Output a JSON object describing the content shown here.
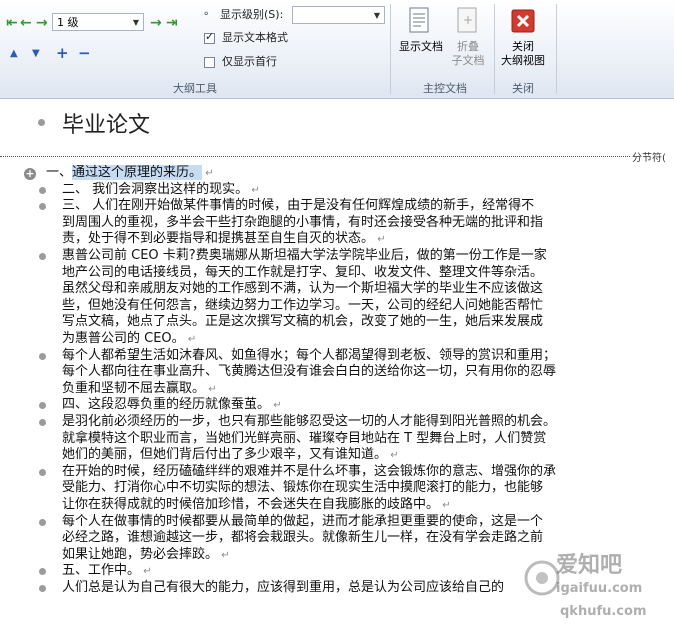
{
  "ribbon": {
    "level_select": "1 级",
    "show_level_label": "显示级别(S):",
    "show_level_value": "",
    "show_text_format": {
      "label": "显示文本格式",
      "checked": true
    },
    "first_line_only": {
      "label": "仅显示首行",
      "checked": false
    },
    "outline_group_label": "大纲工具",
    "show_document": "显示文档",
    "collapse_subdocs_line1": "折叠",
    "collapse_subdocs_line2": "子文档",
    "master_group_label": "主控文档",
    "close_outline_line1": "关闭",
    "close_outline_line2": "大纲视图",
    "close_group_label": "关闭"
  },
  "document": {
    "title": "毕业论文",
    "section_break": "分节符(",
    "paragraph_mark": "↵",
    "lines": [
      "一、通过这个原理的来历。",
      "二、      我们会洞察出这样的现实。",
      "三、      人们在刚开始做某件事情的时候，由于是没有任何辉煌成绩的新手，经常得不",
      "到周围人的重视，多半会干些打杂跑腿的小事情，有时还会接受各种无端的批评和指",
      "责，处于得不到必要指导和提携甚至自生自灭的状态。",
      "惠普公司前 CEO 卡莉?费奥瑞娜从斯坦福大学法学院毕业后，做的第一份工作是一家",
      "地产公司的电话接线员，每天的工作就是打字、复印、收发文件、整理文件等杂活。",
      "虽然父母和亲戚朋友对她的工作感到不满，认为一个斯坦福大学的毕业生不应该做这",
      "些，但她没有任何怨言，继续边努力工作边学习。一天，公司的经纪人问她能否帮忙",
      "写点文稿，她点了点头。正是这次撰写文稿的机会，改变了她的一生，她后来发展成",
      "为惠普公司的 CEO。",
      "每个人都希望生活如沐春风、如鱼得水；每个人都渴望得到老板、领导的赏识和重用；",
      "每个人都向往在事业高升、飞黄腾达但没有谁会白白的送给你这一切，只有用你的忍辱",
      "负重和坚韧不屈去赢取。",
      "四、这段忍辱负重的经历就像蚕茧。",
      "是羽化前必须经历的一步，也只有那些能够忍受这一切的人才能得到阳光普照的机会。",
      "就拿模特这个职业而言，当她们光鲜亮丽、璀璨夺目地站在 T 型舞台上时，人们赞赏",
      "她们的美丽，但她们背后付出了多少艰辛，又有谁知道。",
      "在开始的时候，经历磕磕绊绊的艰难并不是什么坏事，这会锻炼你的意志、增强你的承",
      "受能力、打消你心中不切实际的想法、锻炼你在现实生活中摸爬滚打的能力，也能够",
      "让你在获得成就的时候倍加珍惜，不会迷失在自我膨胀的歧路中。",
      "每个人在做事情的时候都要从最简单的做起，进而才能承担更重要的使命，这是一个",
      "必经之路，谁想逾越这一步，都将会栽跟头。就像新生儿一样，在没有学会走路之前",
      "如果让她跑，势必会摔跤。",
      "五、工作中。",
      "人们总是认为自己有很大的能力，应该得到重用，总是认为公司应该给自己的"
    ]
  },
  "watermark": {
    "brand": "爱知吧",
    "domain1": "igaifuu.com",
    "domain2": "qkhufu.com"
  }
}
